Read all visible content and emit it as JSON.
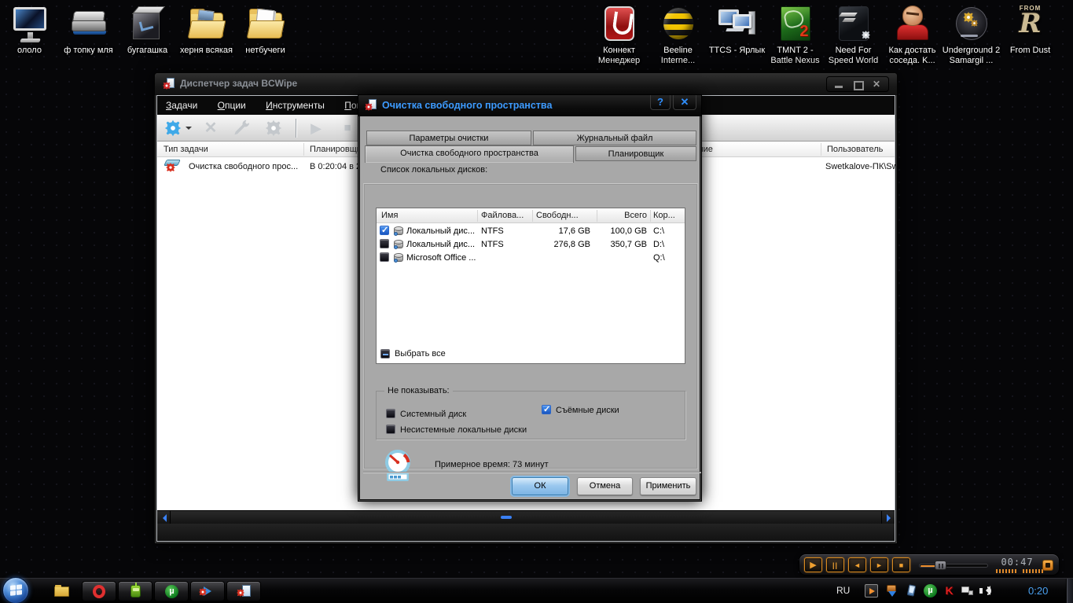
{
  "desktop": {
    "icons": [
      {
        "label": "ололо",
        "icon": "monitor-icon"
      },
      {
        "label": "ф топку мля",
        "icon": "scanner-icon"
      },
      {
        "label": "бугагашка",
        "icon": "black-cube-icon"
      },
      {
        "label": "херня всякая",
        "icon": "folder-pictures-icon"
      },
      {
        "label": "нетбучеги",
        "icon": "folder-documents-icon"
      },
      {
        "label": "Коннект Менеджер",
        "icon": "connect-manager-icon"
      },
      {
        "label": "Beeline Interne...",
        "icon": "beeline-icon"
      },
      {
        "label": "TTCS - Ярлык",
        "icon": "computers-icon"
      },
      {
        "label": "TMNT 2 - Battle Nexus",
        "icon": "tmnt-game-icon"
      },
      {
        "label": "Need For Speed World",
        "icon": "nfs-world-icon"
      },
      {
        "label": "Как достать соседа. K...",
        "icon": "neighbour-game-icon"
      },
      {
        "label": "Underground 2 Samargil ...",
        "icon": "underground2-icon"
      },
      {
        "label": "From Dust",
        "icon": "from-dust-icon"
      }
    ]
  },
  "main_window": {
    "title": "Диспетчер задач BCWipe",
    "menu": [
      "Задачи",
      "Опции",
      "Инструменты",
      "Помощь"
    ],
    "toolbar_icons": [
      "task-gear-dropdown-icon",
      "delete-icon",
      "wrench-icon",
      "settings-gears-icon",
      "run-icon",
      "stop-icon",
      "view-log-icon"
    ],
    "caption_icons": [
      "minimize-icon",
      "maximize-icon",
      "close-icon"
    ],
    "columns": [
      "Тип задачи",
      "Планировщик",
      "Состояние",
      "Пользователь"
    ],
    "task_row": {
      "type": "Очистка свободного прос...",
      "schedule": "В 0:20:04 в 2...",
      "user": "Swetkalove-ПК\\Swe"
    }
  },
  "dialog": {
    "title": "Очистка свободного пространства",
    "help_glyph": "?",
    "close_glyph": "✕",
    "tabs_row1": [
      "Параметры очистки",
      "Журнальный файл"
    ],
    "tabs_row2": [
      "Очистка свободного пространства",
      "Планировщик"
    ],
    "active_tab": "Очистка свободного пространства",
    "list_label": "Список локальных дисков:",
    "table": {
      "headers": [
        "Имя",
        "Файлова...",
        "Свободн...",
        "Всего",
        "Кор..."
      ],
      "rows": [
        {
          "checked": true,
          "name": "Локальный дис...",
          "fs": "NTFS",
          "free": "17,6 GB",
          "total": "100,0 GB",
          "root": "C:\\"
        },
        {
          "checked": false,
          "name": "Локальный дис...",
          "fs": "NTFS",
          "free": "276,8 GB",
          "total": "350,7 GB",
          "root": "D:\\"
        },
        {
          "checked": false,
          "name": "Microsoft Office ...",
          "fs": "",
          "free": "",
          "total": "",
          "root": "Q:\\"
        }
      ]
    },
    "select_all": "Выбрать все",
    "select_all_state": "mixed",
    "group": {
      "legend": "Не показывать:",
      "items": [
        {
          "label": "Системный диск",
          "checked": false
        },
        {
          "label": "Съёмные диски",
          "checked": true
        },
        {
          "label": "Несистемные локальные диски",
          "checked": false
        }
      ]
    },
    "estimate": "Примерное время: 73 минут",
    "estimate_icon": "speedometer-icon",
    "buttons": {
      "ok": "ОК",
      "cancel": "Отмена",
      "apply": "Применить"
    }
  },
  "taskbar": {
    "language": "RU",
    "clock": "0:20",
    "quick_launch_icons": [
      "explorer-folder-icon",
      "opera-icon",
      "robot-player-icon",
      "utorrent-icon",
      "bcwipe-run-icon",
      "bcwipe-document-icon"
    ],
    "tray_icons": [
      "media-play-icon",
      "download-manager-icon",
      "phone-icon",
      "utorrent-icon",
      "kaspersky-icon",
      "network-icon",
      "volume-icon"
    ],
    "start": "start-orb"
  },
  "media_player": {
    "time": "00:47",
    "buttons": [
      "play-icon",
      "pause-icon",
      "rewind-icon",
      "forward-icon",
      "stop-icon",
      "equalizer-button-icon"
    ]
  }
}
